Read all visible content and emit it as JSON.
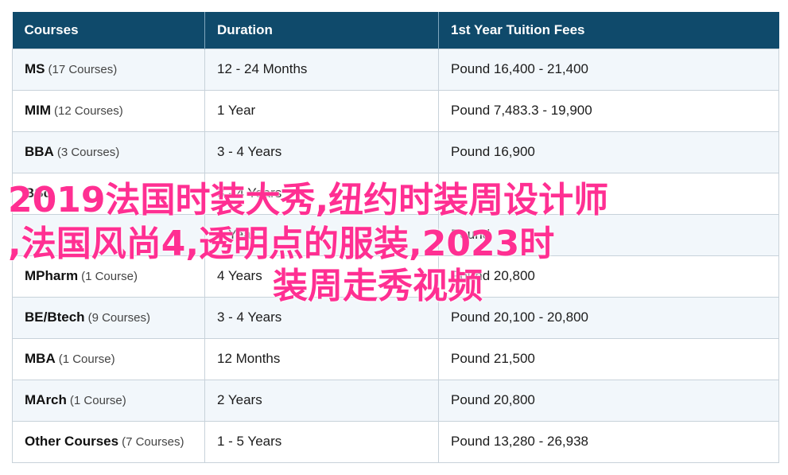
{
  "table": {
    "headers": [
      "Courses",
      "Duration",
      "1st Year Tuition Fees"
    ],
    "rows": [
      {
        "course": "MS",
        "count": "(17 Courses)",
        "duration": "12 - 24 Months",
        "fees": "Pound 16,400 - 21,400"
      },
      {
        "course": "MIM",
        "count": "(12 Courses)",
        "duration": "1 Year",
        "fees": "Pound 7,483.3 - 19,900"
      },
      {
        "course": "BBA",
        "count": "(3 Courses)",
        "duration": "3 - 4 Years",
        "fees": "Pound 16,900"
      },
      {
        "course": "BSc",
        "count": "",
        "duration": "3 - 4 Years",
        "fees": ""
      },
      {
        "course": "",
        "count": "",
        "duration": "1 Year",
        "fees": "Pound"
      },
      {
        "course": "MPharm",
        "count": "(1 Course)",
        "duration": "4 Years",
        "fees": "Pound 20,800"
      },
      {
        "course": "BE/Btech",
        "count": "(9 Courses)",
        "duration": "3 - 4 Years",
        "fees": "Pound 20,100 - 20,800"
      },
      {
        "course": "MBA",
        "count": "(1 Course)",
        "duration": "12 Months",
        "fees": "Pound 21,500"
      },
      {
        "course": "MArch",
        "count": "(1 Course)",
        "duration": "2 Years",
        "fees": "Pound 20,800"
      },
      {
        "course": "Other Courses",
        "count": "(7 Courses)",
        "duration": "1 - 5 Years",
        "fees": "Pound 13,280 - 26,938"
      }
    ]
  },
  "overlay": {
    "line1": "2019法国时装大秀,纽约时装周设计师",
    "line2": ",法国风尚4,透明点的服装,2023时",
    "line3": "装周走秀视频"
  }
}
